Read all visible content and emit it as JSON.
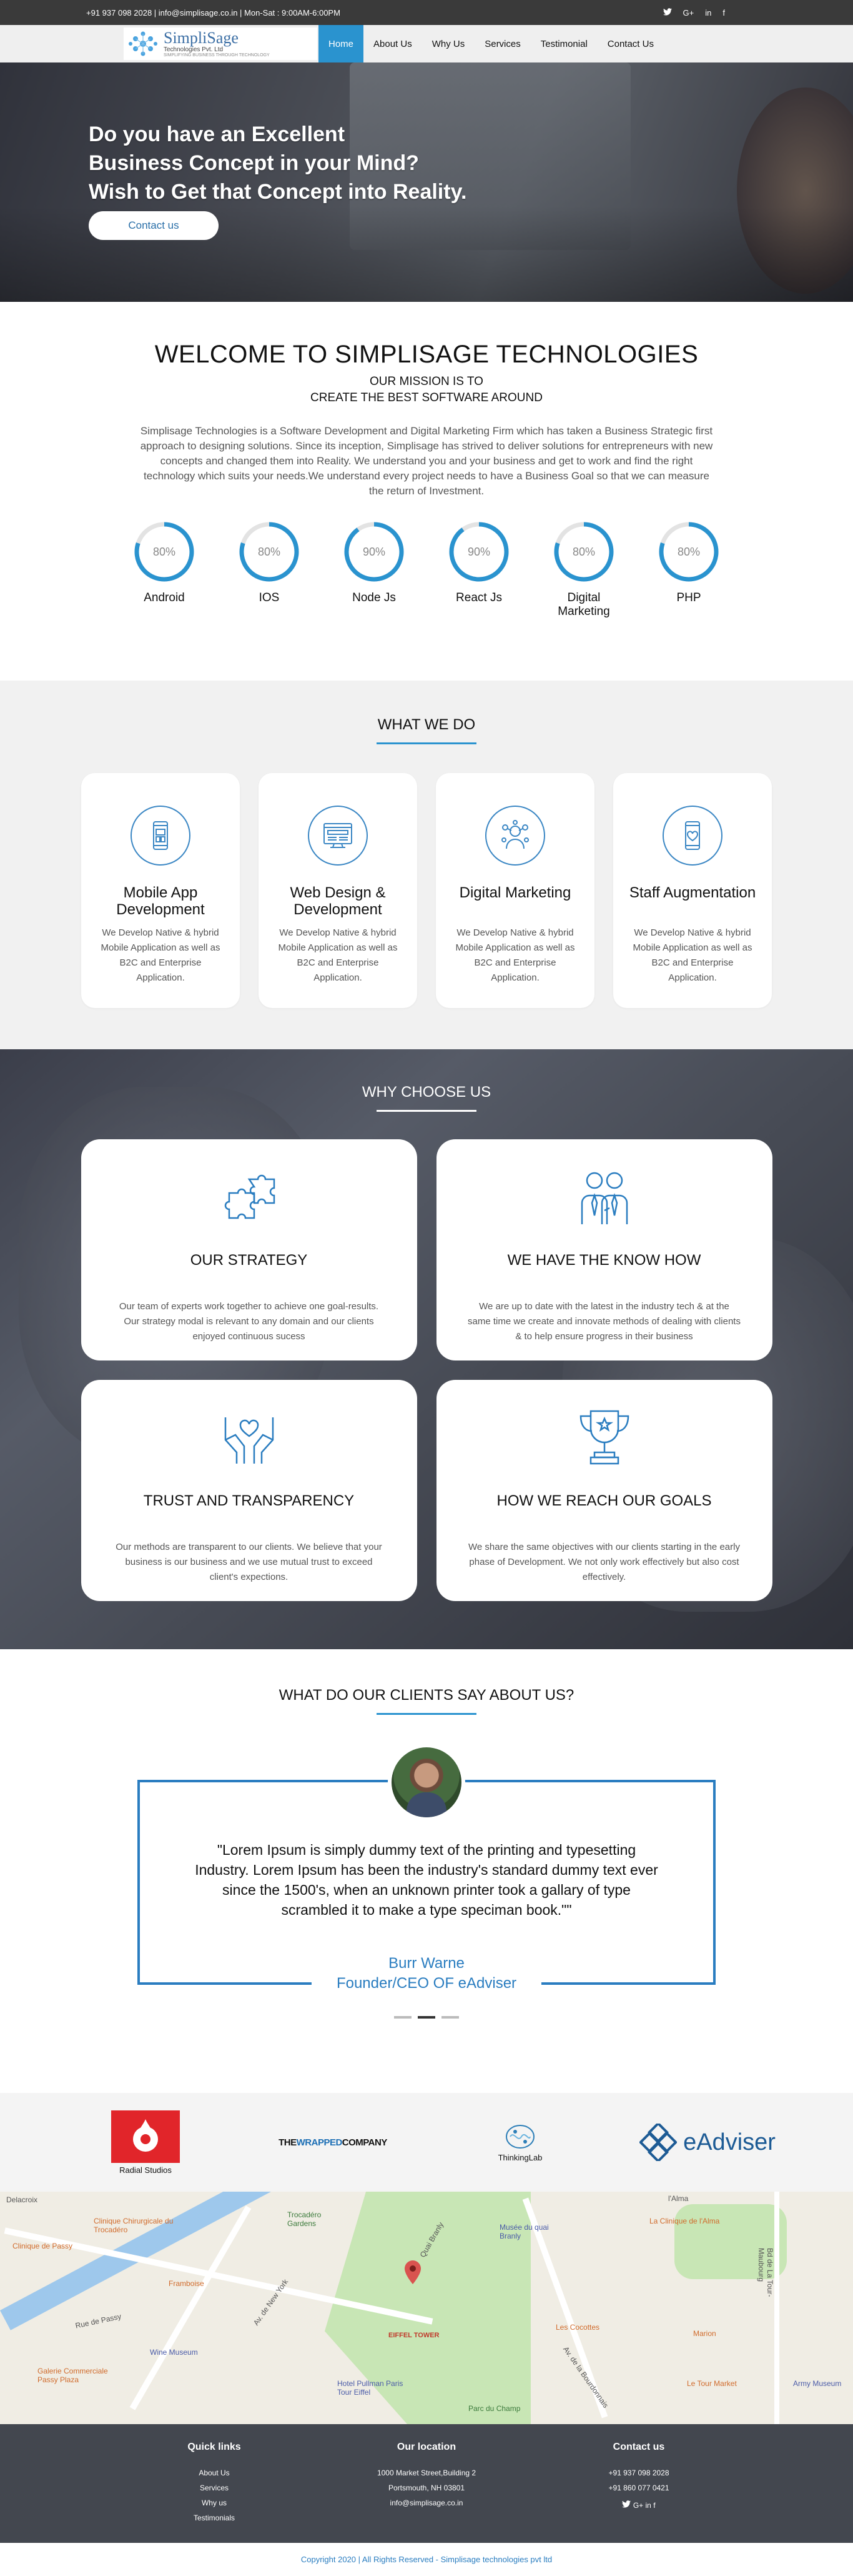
{
  "topbar": {
    "contact": "+91 937 098 2028 | info@simplisage.co.in | Mon-Sat : 9:00AM-6:00PM",
    "social": [
      "twitter-icon",
      "google-plus-icon",
      "linkedin-icon",
      "facebook-icon"
    ],
    "social_glyphs": {
      "twitter": "𝕥",
      "google": "G+",
      "linkedin": "in",
      "facebook": "f"
    }
  },
  "header": {
    "logo_name": "SimpliSage",
    "logo_sub": "Technologies Pvt. Ltd",
    "logo_tag": "SIMPLIFYING BUSINESS THROUGH TECHNOLOGY",
    "nav": [
      {
        "label": "Home",
        "active": true
      },
      {
        "label": "About Us"
      },
      {
        "label": "Why Us"
      },
      {
        "label": "Services"
      },
      {
        "label": "Testimonial"
      },
      {
        "label": "Contact Us"
      }
    ]
  },
  "hero": {
    "line1": "Do you have an Excellent",
    "line2": "Business Concept in your Mind?",
    "line3": "Wish to Get that Concept into Reality.",
    "button": "Contact us"
  },
  "welcome": {
    "title": "WELCOME TO SIMPLISAGE TECHNOLOGIES",
    "mission1": "OUR MISSION IS TO",
    "mission2": "CREATE THE BEST SOFTWARE AROUND",
    "intro": "Simplisage Technologies is a Software Development and Digital Marketing Firm which has taken a Business Strategic first approach to designing solutions. Since its inception, Simplisage has strived to deliver solutions for entrepreneurs with new concepts and changed them into Reality. We understand you and your business and get to work and find the right technology which suits your needs.We understand every project needs to have a Business Goal so that we can measure the return of Investment.",
    "skills": [
      {
        "name": "Android",
        "percent": 80,
        "label": "80%"
      },
      {
        "name": "IOS",
        "percent": 80,
        "label": "80%"
      },
      {
        "name": "Node Js",
        "percent": 90,
        "label": "90%"
      },
      {
        "name": "React Js",
        "percent": 90,
        "label": "90%"
      },
      {
        "name": "Digital Marketing",
        "percent": 80,
        "label": "80%"
      },
      {
        "name": "PHP",
        "percent": 80,
        "label": "80%"
      }
    ]
  },
  "whatwedo": {
    "title": "WHAT WE DO",
    "cards": [
      {
        "title": "Mobile App Development",
        "text": "We Develop Native & hybrid Mobile Application as well as B2C and Enterprise Application.",
        "icon": "mobile-app-icon"
      },
      {
        "title": "Web Design & Development",
        "text": "We Develop Native & hybrid Mobile Application as well as B2C and Enterprise Application.",
        "icon": "web-design-icon"
      },
      {
        "title": "Digital Marketing",
        "text": "We Develop Native & hybrid Mobile Application as well as B2C and Enterprise Application.",
        "icon": "digital-marketing-icon"
      },
      {
        "title": "Staff Augmentation",
        "text": "We Develop Native & hybrid Mobile Application as well as B2C and Enterprise Application.",
        "icon": "staff-augmentation-icon"
      }
    ]
  },
  "why": {
    "title": "WHY CHOOSE US",
    "cards": [
      {
        "title": "OUR STRATEGY",
        "text": "Our team of experts work together to achieve one goal-results. Our strategy modal is relevant to any domain and our clients enjoyed continuous sucess",
        "icon": "puzzle-icon"
      },
      {
        "title": "WE HAVE THE KNOW HOW",
        "text": "We are up to date with the latest in the industry tech & at the same time we create and innovate methods of dealing with clients & to help ensure progress in their business",
        "icon": "team-icon"
      },
      {
        "title": "TRUST AND TRANSPARENCY",
        "text": "Our methods are transparent to our clients. We believe that your business is our business and we use mutual trust to exceed client's expections.",
        "icon": "hands-heart-icon"
      },
      {
        "title": "HOW WE REACH OUR GOALS",
        "text": "We share the same objectives with our clients starting in the early phase of Development. We not only work effectively but also cost effectively.",
        "icon": "trophy-icon"
      }
    ]
  },
  "testimonials": {
    "title": "WHAT DO OUR CLIENTS SAY ABOUT US?",
    "quote": "\"Lorem Ipsum is simply dummy text of the printing and typesetting Industry. Lorem Ipsum has been the industry's standard dummy text ever since the 1500's, when an unknown printer took a gallary of type scrambled it to make a type speciman book.\"\"",
    "author_name": "Burr Warne",
    "author_role": "Founder/CEO OF eAdviser",
    "slides": 3,
    "active_slide": 2
  },
  "clients": {
    "radial": "Radial Studios",
    "wrapped_prefix": "THE",
    "wrapped_mid": "WRAPPED",
    "wrapped_suffix": "COMPANY",
    "thinking": "ThinkingLab",
    "eadviser": "eAdviser"
  },
  "map": {
    "labels": [
      "Delacroix",
      "Clinique Chirurgicale du Trocadéro",
      "Trocadéro Gardens",
      "Musée du quai Branly",
      "La Clinique de l'Alma",
      "Framboise",
      "Rue de Passy",
      "Wine Museum",
      "Galerie Commerciale Passy Plaza",
      "EIFFEL TOWER",
      "Les Cocottes",
      "Marion",
      "Hotel Pullman Paris Tour Eiffel",
      "Parc du Champ",
      "Army Museum",
      "Le Tour Market",
      "Av. de New York",
      "Quai Branly",
      "Av. de la Bourdonnais",
      "Bd de La Tour-Maubourg",
      "l'Alma",
      "Clinique de Passy"
    ]
  },
  "footer": {
    "quick_title": "Quick links",
    "quick_links": [
      "About Us",
      "Services",
      "Why us",
      "Testimonials"
    ],
    "location_title": "Our location",
    "address1": "1000 Market Street,Building 2",
    "address2": "Portsmouth, NH 03801",
    "email": "info@simplisage.co.in",
    "contact_title": "Contact us",
    "phone1": "+91 937 098 2028",
    "phone2": "+91 860 077 0421",
    "copyright": "Copyright 2020 | All Rights Reserved - Simplisage technologies pvt ltd"
  },
  "colors": {
    "accent": "#2a93cf",
    "dark": "#3a3a3a",
    "footer": "#43474f"
  }
}
